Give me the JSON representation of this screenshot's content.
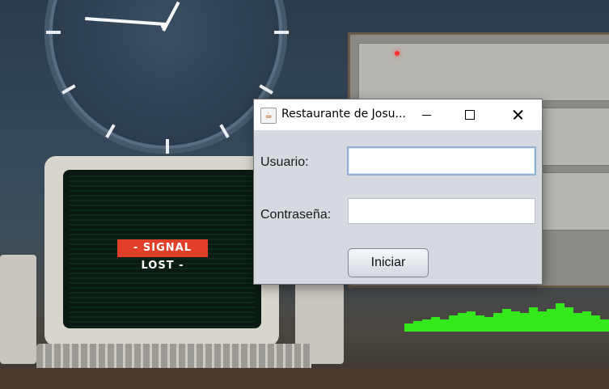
{
  "window": {
    "title": "Restaurante de Josu...",
    "app_icon": "java-cup-icon",
    "controls": {
      "minimize": "minimize-icon",
      "maximize": "maximize-icon",
      "close": "close-icon"
    }
  },
  "form": {
    "user_label": "Usuario:",
    "user_value": "",
    "password_label": "Contraseña:",
    "password_value": "",
    "submit_label": "Iniciar"
  },
  "wallpaper": {
    "screen_banner": "- SIGNAL LOST -",
    "equalizer_levels": [
      0.2,
      0.25,
      0.3,
      0.35,
      0.3,
      0.4,
      0.45,
      0.5,
      0.4,
      0.35,
      0.45,
      0.55,
      0.5,
      0.45,
      0.6,
      0.5,
      0.55,
      0.7,
      0.6,
      0.45,
      0.5,
      0.4,
      0.3
    ],
    "accent_green": "#35e81c",
    "banner_red": "#e0402a"
  }
}
